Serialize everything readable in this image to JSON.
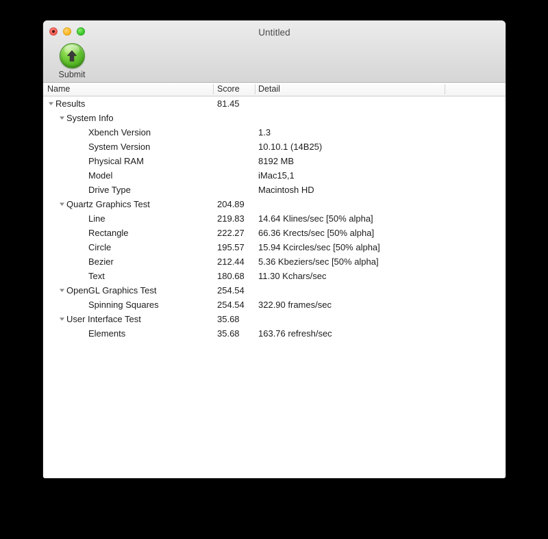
{
  "window": {
    "title": "Untitled",
    "traffic_lights": {
      "close_label": "close",
      "minimize_label": "minimize",
      "zoom_label": "zoom"
    }
  },
  "toolbar": {
    "submit_label": "Submit",
    "submit_icon": "upload-arrow-icon"
  },
  "table": {
    "columns": {
      "name": "Name",
      "score": "Score",
      "detail": "Detail"
    },
    "rows": [
      {
        "level": 0,
        "expandable": true,
        "expanded": true,
        "name": "Results",
        "score": "81.45",
        "detail": ""
      },
      {
        "level": 1,
        "expandable": true,
        "expanded": true,
        "name": "System Info",
        "score": "",
        "detail": ""
      },
      {
        "level": 2,
        "expandable": false,
        "expanded": false,
        "name": "Xbench Version",
        "score": "",
        "detail": "1.3"
      },
      {
        "level": 2,
        "expandable": false,
        "expanded": false,
        "name": "System Version",
        "score": "",
        "detail": "10.10.1 (14B25)"
      },
      {
        "level": 2,
        "expandable": false,
        "expanded": false,
        "name": "Physical RAM",
        "score": "",
        "detail": "8192 MB"
      },
      {
        "level": 2,
        "expandable": false,
        "expanded": false,
        "name": "Model",
        "score": "",
        "detail": "iMac15,1"
      },
      {
        "level": 2,
        "expandable": false,
        "expanded": false,
        "name": "Drive Type",
        "score": "",
        "detail": "Macintosh HD"
      },
      {
        "level": 1,
        "expandable": true,
        "expanded": true,
        "name": "Quartz Graphics Test",
        "score": "204.89",
        "detail": ""
      },
      {
        "level": 2,
        "expandable": false,
        "expanded": false,
        "name": "Line",
        "score": "219.83",
        "detail": "14.64 Klines/sec [50% alpha]"
      },
      {
        "level": 2,
        "expandable": false,
        "expanded": false,
        "name": "Rectangle",
        "score": "222.27",
        "detail": "66.36 Krects/sec [50% alpha]"
      },
      {
        "level": 2,
        "expandable": false,
        "expanded": false,
        "name": "Circle",
        "score": "195.57",
        "detail": "15.94 Kcircles/sec [50% alpha]"
      },
      {
        "level": 2,
        "expandable": false,
        "expanded": false,
        "name": "Bezier",
        "score": "212.44",
        "detail": "5.36 Kbeziers/sec [50% alpha]"
      },
      {
        "level": 2,
        "expandable": false,
        "expanded": false,
        "name": "Text",
        "score": "180.68",
        "detail": "11.30 Kchars/sec"
      },
      {
        "level": 1,
        "expandable": true,
        "expanded": true,
        "name": "OpenGL Graphics Test",
        "score": "254.54",
        "detail": ""
      },
      {
        "level": 2,
        "expandable": false,
        "expanded": false,
        "name": "Spinning Squares",
        "score": "254.54",
        "detail": "322.90 frames/sec"
      },
      {
        "level": 1,
        "expandable": true,
        "expanded": true,
        "name": "User Interface Test",
        "score": "35.68",
        "detail": ""
      },
      {
        "level": 2,
        "expandable": false,
        "expanded": false,
        "name": "Elements",
        "score": "35.68",
        "detail": "163.76 refresh/sec"
      }
    ]
  },
  "colors": {
    "window_background": "#ffffff",
    "titlebar_top": "#ececec",
    "titlebar_bottom": "#d6d6d6",
    "close_button": "#f5655c",
    "minimize_button": "#ffbd2e",
    "zoom_button": "#45cd32",
    "submit_icon_green": "#63c22f",
    "text": "#1c1c1c",
    "title_text": "#4a4a4a",
    "page_background": "#000000"
  }
}
